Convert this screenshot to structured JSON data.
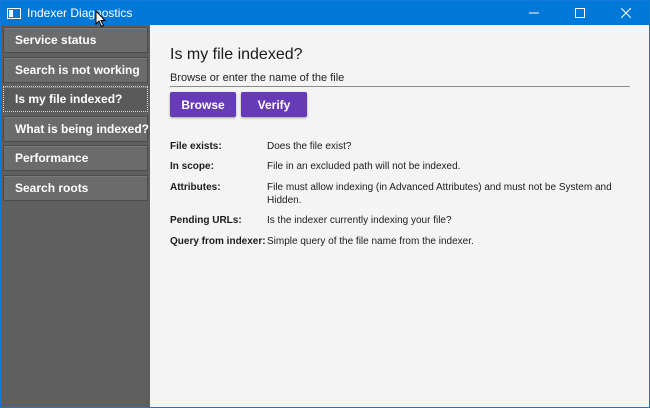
{
  "window": {
    "title": "Indexer Diagnostics",
    "controls": {
      "minimize": "minimize-icon",
      "maximize": "maximize-icon",
      "close": "close-icon"
    }
  },
  "colors": {
    "titlebar": "#0078d7",
    "sidebar": "#5f5f5f",
    "nav_item": "#6b6b6b",
    "button": "#673ab7",
    "content_bg": "#f4f4f4"
  },
  "sidebar": {
    "items": [
      {
        "label": "Service status",
        "active": false
      },
      {
        "label": "Search is not working",
        "active": false
      },
      {
        "label": "Is my file indexed?",
        "active": true
      },
      {
        "label": "What is being indexed?",
        "active": false
      },
      {
        "label": "Performance",
        "active": false
      },
      {
        "label": "Search roots",
        "active": false
      }
    ]
  },
  "main": {
    "title": "Is my file indexed?",
    "file_input": {
      "value": "",
      "placeholder": "Browse or enter the name of the file"
    },
    "buttons": {
      "browse": "Browse",
      "verify": "Verify"
    },
    "info": [
      {
        "label": "File exists:",
        "description": "Does the file exist?"
      },
      {
        "label": "In scope:",
        "description": "File in an excluded path will not be indexed."
      },
      {
        "label": "Attributes:",
        "description": "File must allow indexing (in Advanced Attributes) and must not be System and Hidden."
      },
      {
        "label": "Pending URLs:",
        "description": "Is the indexer currently indexing your file?"
      },
      {
        "label": "Query from indexer:",
        "description": "Simple query of the file name from the indexer."
      }
    ]
  }
}
